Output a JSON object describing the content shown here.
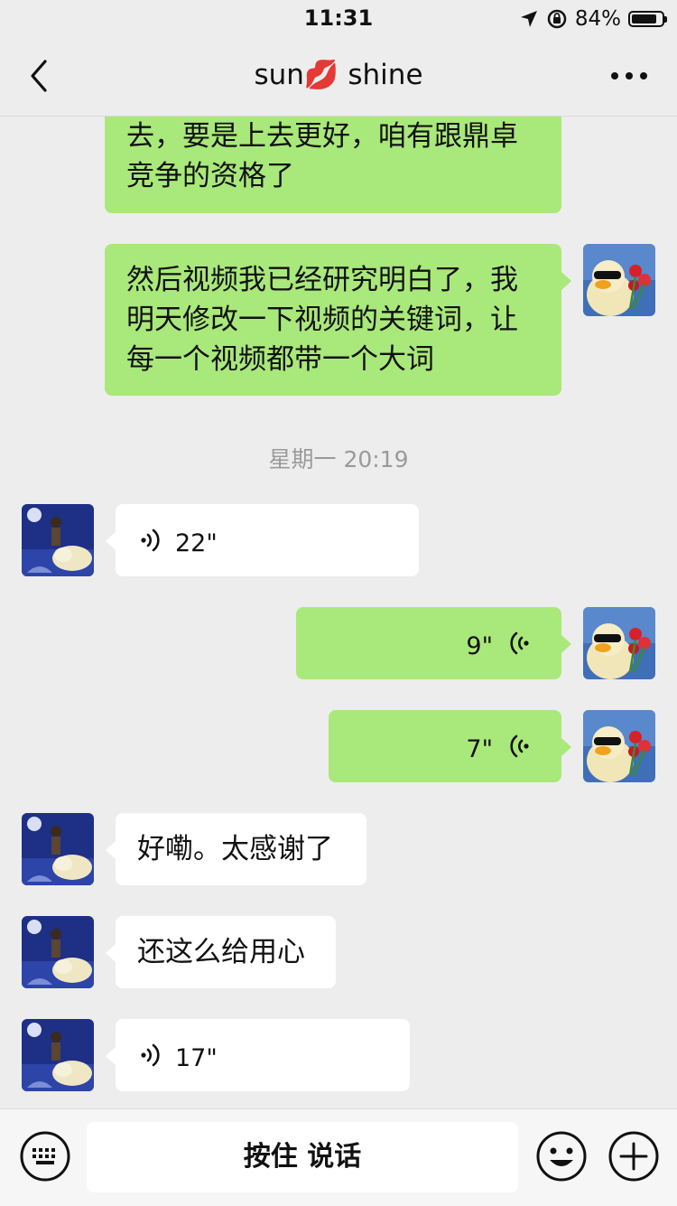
{
  "status_bar": {
    "time": "11:31",
    "battery": "84%",
    "battery_level": 0.84
  },
  "nav": {
    "title": "sun💋 shine",
    "back_icon": "chevron-left-icon",
    "more_icon": "more-dots-icon"
  },
  "messages": {
    "m1": {
      "line1": "去，要是上去更好，咱有跟鼎卓",
      "line2": "竞争的资格了"
    },
    "m2": {
      "line1": "然后视频我已经研究明白了，我",
      "line2": "明天修改一下视频的关键词，让",
      "line3": "每一个视频都带一个大词"
    },
    "timestamp": "星期一 20:19",
    "v1": {
      "duration": "22\""
    },
    "v2": {
      "duration": "9\""
    },
    "v3": {
      "duration": "7\""
    },
    "t1": {
      "text": "好嘞。太感谢了"
    },
    "t2": {
      "text": "还这么给用心"
    },
    "v4": {
      "duration": "17\""
    }
  },
  "input_bar": {
    "hold_to_talk": "按住 说话",
    "keyboard_icon": "keyboard-icon",
    "emoji_icon": "emoji-icon",
    "plus_icon": "plus-icon"
  },
  "colors": {
    "sent_bubble": "#a9e87a",
    "received_bubble": "#ffffff",
    "background": "#ededed"
  }
}
